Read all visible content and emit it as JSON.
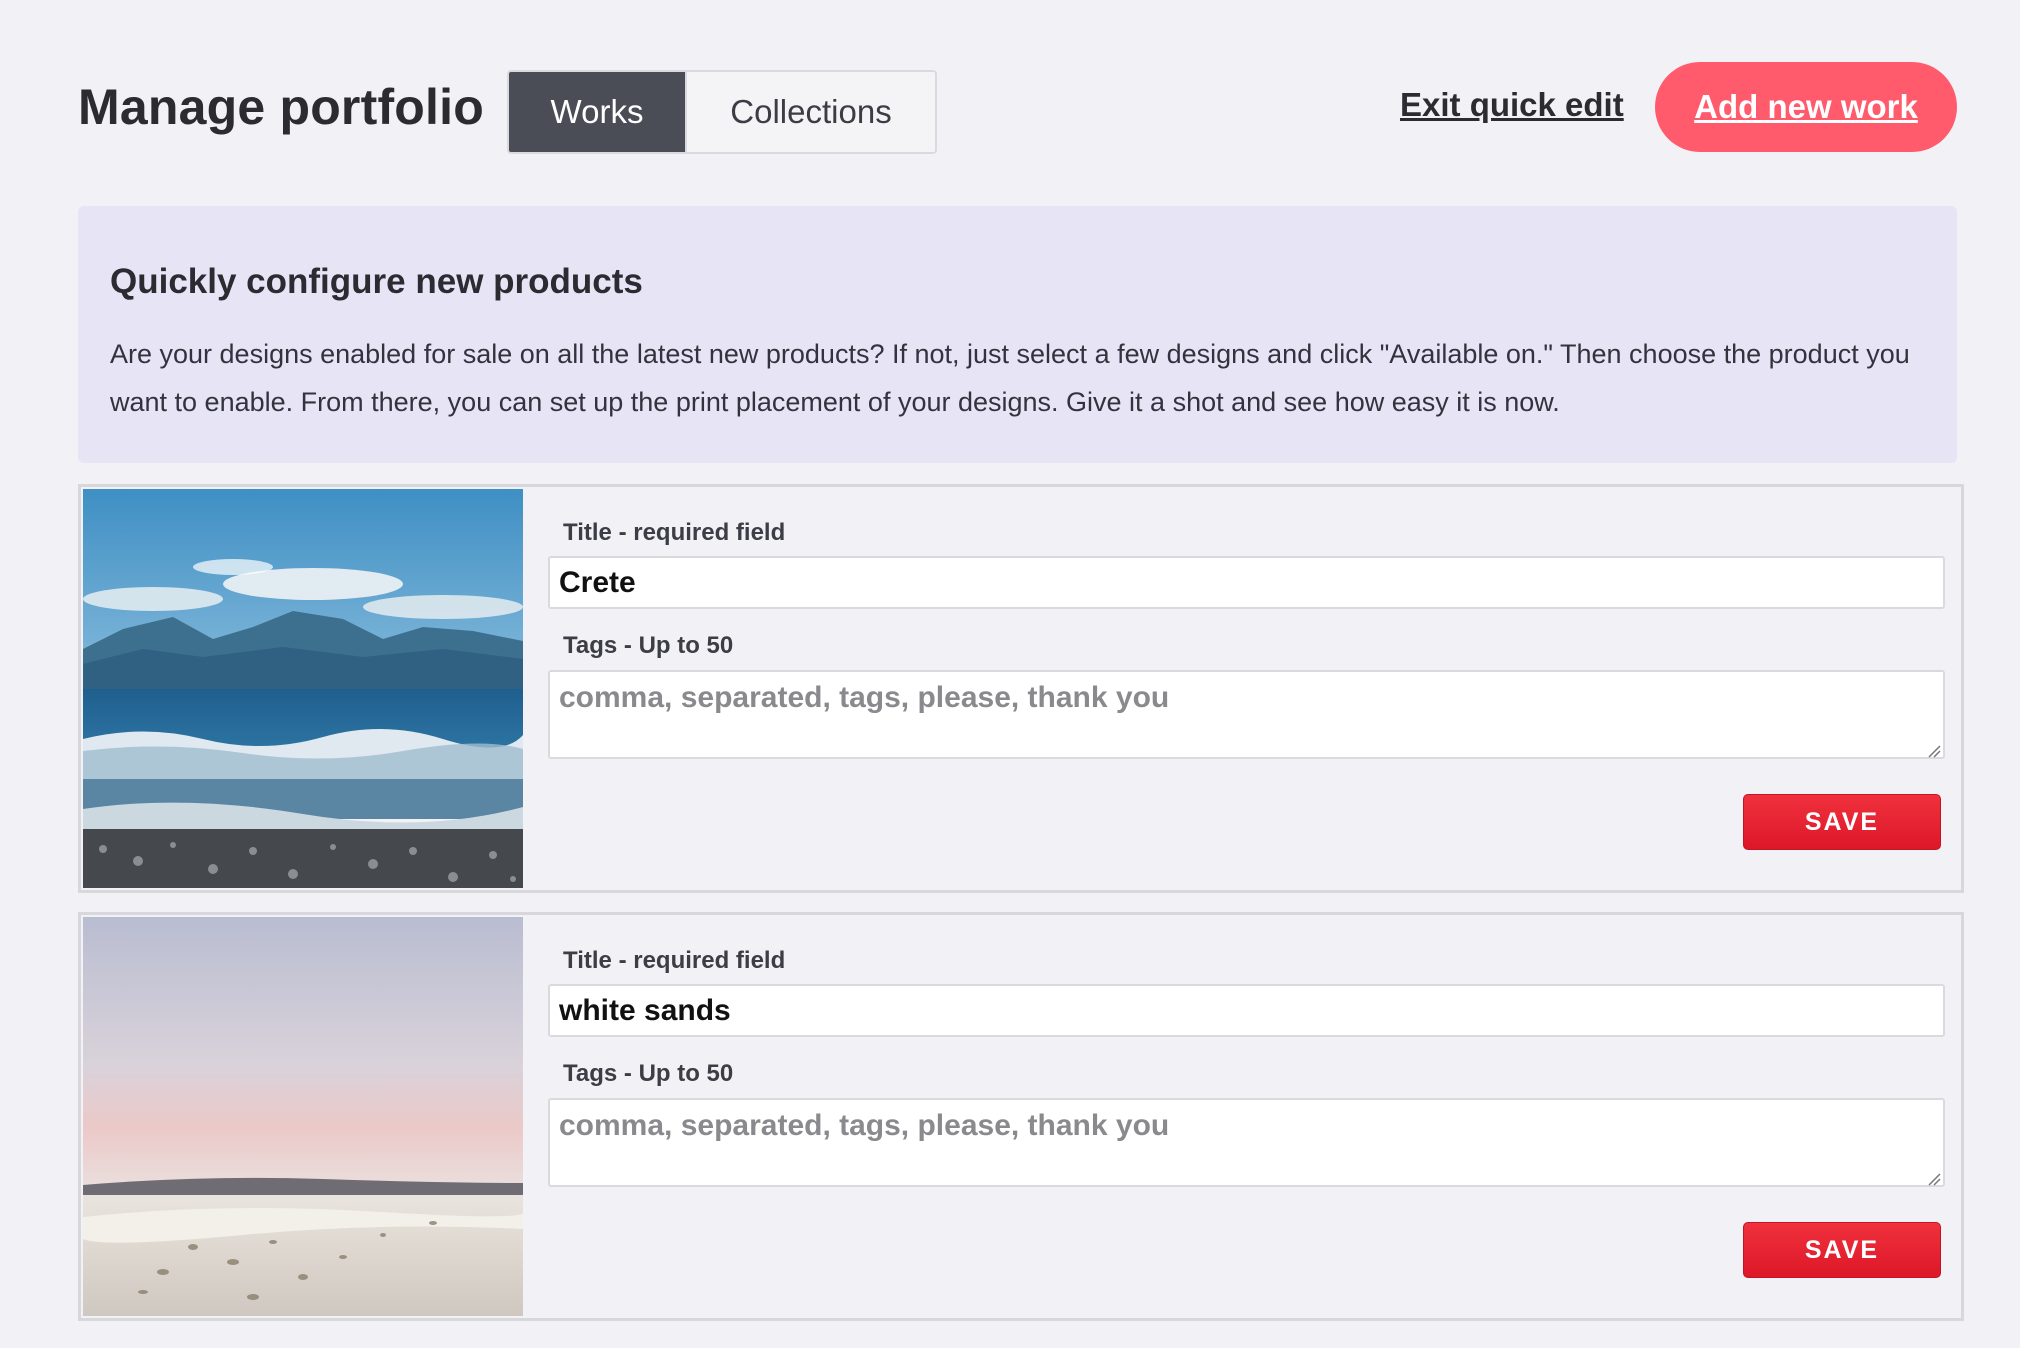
{
  "header": {
    "title": "Manage portfolio",
    "tabs": [
      {
        "label": "Works",
        "active": true
      },
      {
        "label": "Collections",
        "active": false
      }
    ],
    "exit_link": "Exit quick edit",
    "add_button": "Add new work"
  },
  "banner": {
    "title": "Quickly configure new products",
    "text": "Are your designs enabled for sale on all the latest new products? If not, just select a few designs and click \"Available on.\" Then choose the product you want to enable. From there, you can set up the print placement of your designs. Give it a shot and see how easy it is now."
  },
  "works": [
    {
      "image": "crete-beach-photo",
      "title_label": "Title - required field",
      "title_value": "Crete",
      "tags_label": "Tags - Up to 50",
      "tags_placeholder": "comma, separated, tags, please, thank you",
      "save_label": "SAVE"
    },
    {
      "image": "white-sands-photo",
      "title_label": "Title - required field",
      "title_value": "white sands",
      "tags_label": "Tags - Up to 50",
      "tags_placeholder": "comma, separated, tags, please, thank you",
      "save_label": "SAVE"
    }
  ],
  "colors": {
    "accent": "#ff5b6d",
    "save": "#e82332",
    "active_tab": "#4a4d55",
    "banner_bg": "#e7e4f6"
  }
}
